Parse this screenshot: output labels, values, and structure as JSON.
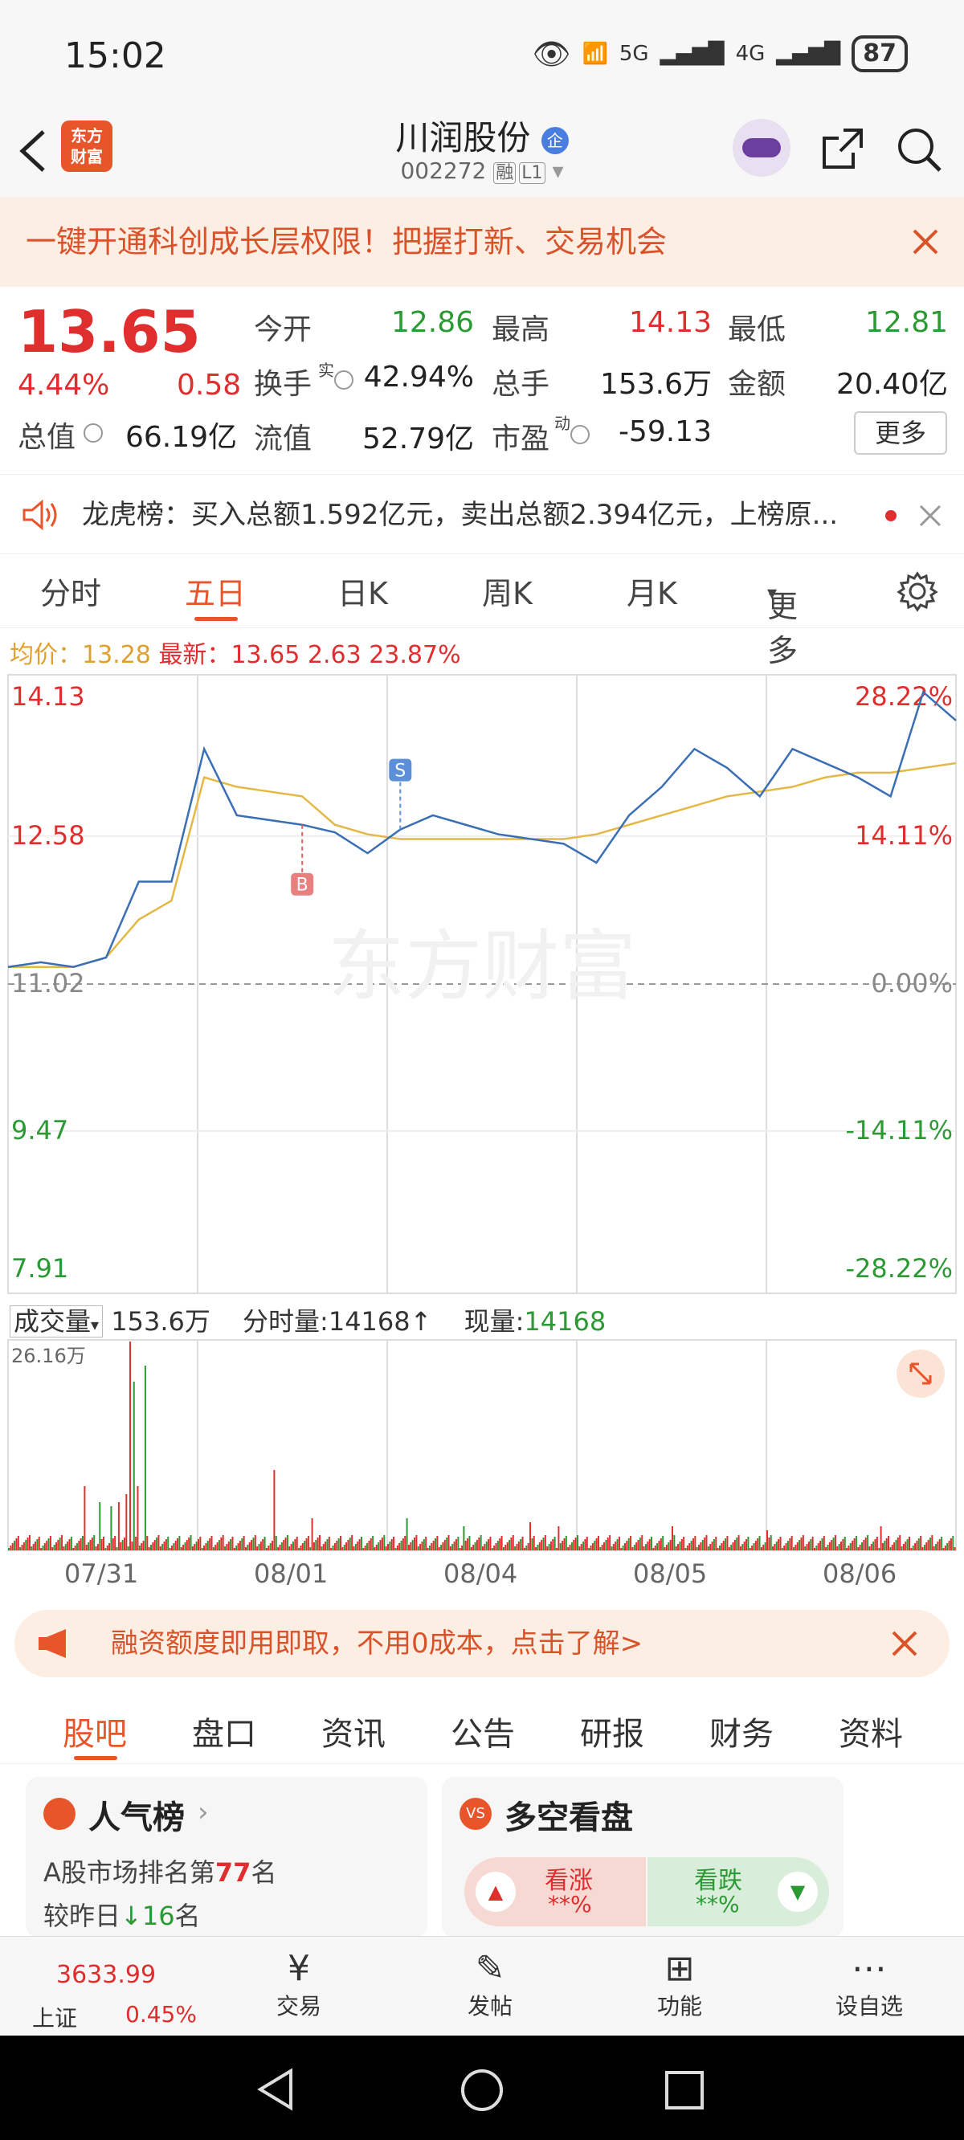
{
  "status_bar": {
    "time": "15:02",
    "battery": "87",
    "signal1": "5G",
    "signal2": "4G"
  },
  "header": {
    "logo_text": "东方\n财富",
    "title": "川润股份",
    "badge": "企",
    "code": "002272",
    "tag1": "融",
    "tag2": "L1"
  },
  "promo": {
    "text": "一键开通科创成长层权限！把握打新、交易机会"
  },
  "quote": {
    "price": "13.65",
    "change_pct": "4.44%",
    "change": "0.58",
    "open_label": "今开",
    "open": "12.86",
    "high_label": "最高",
    "high": "14.13",
    "low_label": "最低",
    "low": "12.81",
    "turnover_label": "换手",
    "turnover_sup": "实",
    "turnover": "42.94%",
    "volume_label": "总手",
    "volume": "153.6万",
    "amount_label": "金额",
    "amount": "20.40亿",
    "mcap_label": "总值",
    "mcap": "66.19亿",
    "float_label": "流值",
    "float": "52.79亿",
    "pe_label": "市盈",
    "pe_sup": "动",
    "pe": "-59.13",
    "more": "更多"
  },
  "lhb": {
    "text": "龙虎榜：买入总额1.592亿元，卖出总额2.394亿元，上榜原..."
  },
  "tabs": {
    "t1": "分时",
    "t2": "五日",
    "t3": "日K",
    "t4": "周K",
    "t5": "月K",
    "t6": "更多"
  },
  "avg_line": {
    "avg_label": "均价：",
    "avg": "13.28",
    "latest_label": "最新：",
    "latest": "13.65",
    "chg": "2.63",
    "pct": "23.87%"
  },
  "chart_data": {
    "type": "line",
    "title": "",
    "y_labels_left": [
      "14.13",
      "12.58",
      "11.02",
      "9.47",
      "7.91"
    ],
    "y_labels_right": [
      "28.22%",
      "14.11%",
      "0.00%",
      "-14.11%",
      "-28.22%"
    ],
    "ylim": [
      7.91,
      14.13
    ],
    "x": [
      "07/31",
      "08/01",
      "08/04",
      "08/05",
      "08/06"
    ],
    "series": [
      {
        "name": "",
        "values": [
          11.2,
          11.25,
          11.2,
          11.3,
          12.1,
          12.1,
          13.5,
          12.8,
          12.75,
          12.7,
          12.62,
          12.4,
          12.65,
          12.8,
          12.7,
          12.6,
          12.55,
          12.5,
          12.3,
          12.8,
          13.1,
          13.5,
          13.3,
          13.0,
          13.5,
          13.35,
          13.2,
          13.0,
          14.1,
          13.8
        ]
      },
      {
        "name": "",
        "values": [
          11.2,
          11.2,
          11.2,
          11.3,
          11.7,
          11.9,
          13.2,
          13.1,
          13.05,
          13.0,
          12.7,
          12.6,
          12.55,
          12.55,
          12.55,
          12.55,
          12.55,
          12.55,
          12.6,
          12.7,
          12.8,
          12.9,
          13.0,
          13.05,
          13.1,
          13.2,
          13.25,
          13.25,
          13.3,
          13.35
        ]
      }
    ],
    "markers": [
      "B",
      "S"
    ],
    "watermark": "东方财富"
  },
  "volume": {
    "label": "成交量",
    "total": "153.6万",
    "fs_label": "分时量:",
    "fs": "14168",
    "now_label": "现量:",
    "now": "14168",
    "max_label": "26.16万"
  },
  "banner": {
    "text": "融资额度即用即取，不用0成本，点击了解>"
  },
  "sectabs": [
    "股吧",
    "盘口",
    "资讯",
    "公告",
    "研报",
    "财务",
    "资料"
  ],
  "card1": {
    "title": "人气榜",
    "rank_prefix": "A股市场排名第",
    "rank": "77",
    "rank_suffix": "名",
    "change_prefix": "较昨日",
    "change": "16",
    "change_suffix": "名"
  },
  "card2": {
    "title": "多空看盘",
    "up": "看涨",
    "up_pct": "**%",
    "down": "看跌",
    "down_pct": "**%"
  },
  "bottom": {
    "index": "3633.99",
    "index_name": "上证",
    "index_pct": "0.45%",
    "b1": "交易",
    "b2": "发帖",
    "b3": "功能",
    "b4": "设自选"
  }
}
